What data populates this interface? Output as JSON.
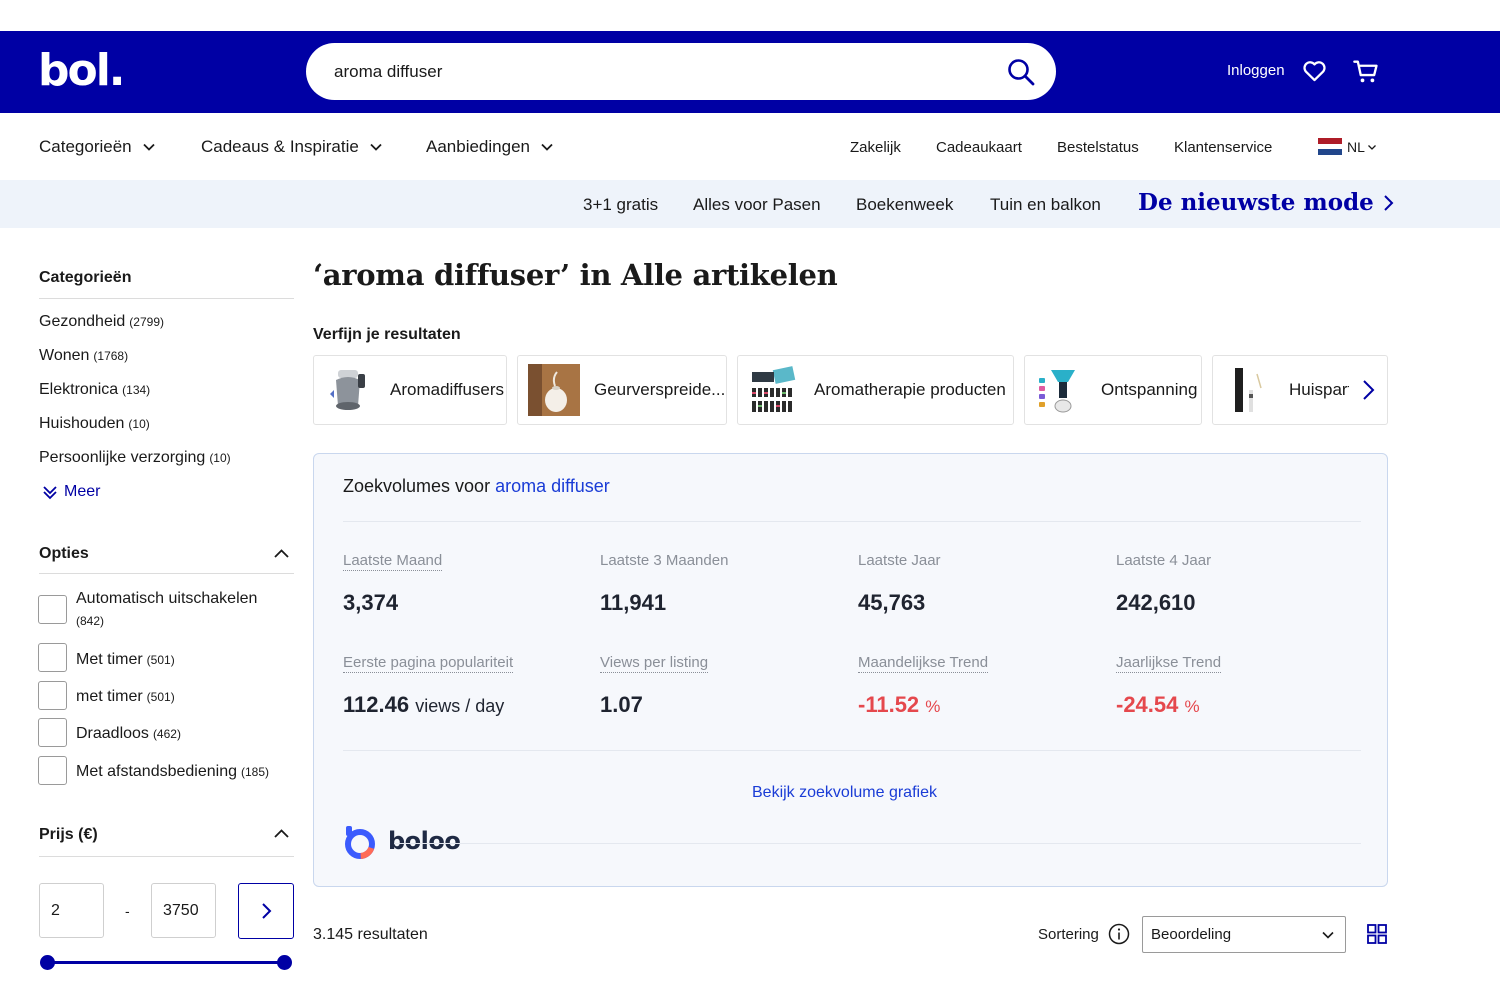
{
  "header": {
    "logo": "bol.",
    "search_value": "aroma diffuser",
    "login_label": "Inloggen"
  },
  "nav": {
    "menus": [
      "Categorieën",
      "Cadeaus & Inspiratie",
      "Aanbiedingen"
    ],
    "links": [
      "Zakelijk",
      "Cadeaukaart",
      "Bestelstatus",
      "Klantenservice"
    ],
    "language": "NL"
  },
  "promo": {
    "links": [
      "3+1 gratis",
      "Alles voor Pasen",
      "Boekenweek",
      "Tuin en balkon"
    ],
    "highlight": "De nieuwste mode"
  },
  "sidebar": {
    "categories_title": "Categorieën",
    "categories": [
      {
        "label": "Gezondheid",
        "count": "(2799)"
      },
      {
        "label": "Wonen",
        "count": "(1768)"
      },
      {
        "label": "Elektronica",
        "count": "(134)"
      },
      {
        "label": "Huishouden",
        "count": "(10)"
      },
      {
        "label": "Persoonlijke verzorging",
        "count": "(10)"
      }
    ],
    "more_label": "Meer",
    "options_title": "Opties",
    "options": [
      {
        "label": "Automatisch uitschakelen",
        "count": "(842)"
      },
      {
        "label": "Met timer",
        "count": "(501)"
      },
      {
        "label": "met timer",
        "count": "(501)"
      },
      {
        "label": "Draadloos",
        "count": "(462)"
      },
      {
        "label": "Met afstandsbediening",
        "count": "(185)"
      }
    ],
    "price_title": "Prijs (€)",
    "price_min": "2",
    "price_sep": "-",
    "price_max": "3750"
  },
  "main": {
    "title": "‘aroma diffuser’ in Alle artikelen",
    "refine_title": "Verfijn je resultaten",
    "chips": [
      "Aromadiffusers",
      "Geurverspreide...",
      "Aromatherapie producten",
      "Ontspanning",
      "Huisparfum"
    ]
  },
  "boloo": {
    "title_prefix": "Zoekvolumes voor",
    "keyword": "aroma diffuser",
    "stats_row1": [
      {
        "label": "Laatste Maand",
        "value": "3,374"
      },
      {
        "label": "Laatste 3 Maanden",
        "value": "11,941"
      },
      {
        "label": "Laatste Jaar",
        "value": "45,763"
      },
      {
        "label": "Laatste 4 Jaar",
        "value": "242,610"
      }
    ],
    "stats_row2": [
      {
        "label": "Eerste pagina populariteit",
        "value": "112.46",
        "unit": "views / day"
      },
      {
        "label": "Views per listing",
        "value": "1.07"
      },
      {
        "label": "Maandelijkse Trend",
        "value": "-11.52",
        "unit": "%"
      },
      {
        "label": "Jaarlijkse Trend",
        "value": "-24.54",
        "unit": "%"
      }
    ],
    "link_label": "Bekijk zoekvolume grafiek",
    "brand": "boloo"
  },
  "results": {
    "count_label": "3.145 resultaten",
    "sort_label": "Sortering",
    "sort_value": "Beoordeling"
  },
  "colors": {
    "brand_blue": "#0000a4",
    "link_blue": "#1a3cd6",
    "negative_red": "#e5484d",
    "promo_bg": "#eef3fa"
  }
}
